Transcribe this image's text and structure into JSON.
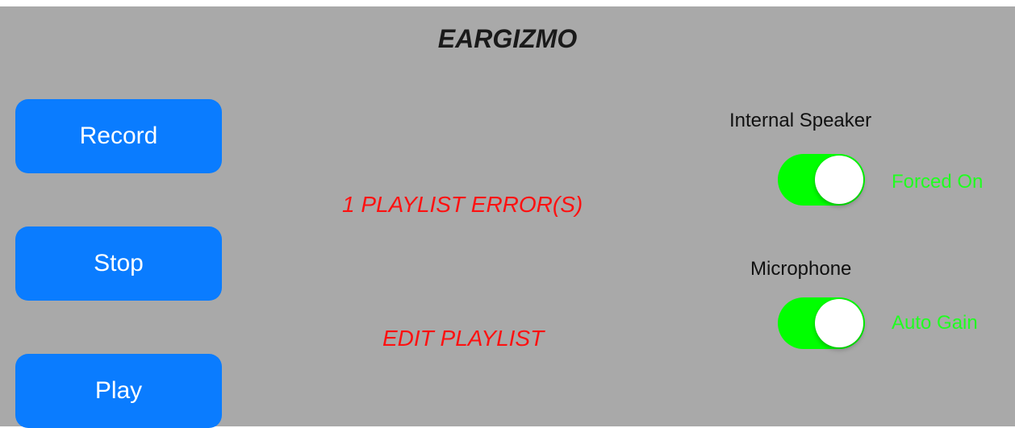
{
  "app": {
    "title": "EARGIZMO"
  },
  "buttons": {
    "record_label": "Record",
    "stop_label": "Stop",
    "play_label": "Play"
  },
  "playlist": {
    "error_text": "1 PLAYLIST ERROR(S)",
    "edit_label": "EDIT PLAYLIST"
  },
  "internal_speaker": {
    "label": "Internal Speaker",
    "toggle_on": true,
    "state_text": "Forced On"
  },
  "microphone": {
    "label": "Microphone",
    "toggle_on": true,
    "state_text": "Auto Gain"
  },
  "colors": {
    "background": "#a9a9a9",
    "button": "#0a7cff",
    "link": "#ff1111",
    "toggle_on": "#00ff00",
    "state_text": "#20ff20"
  }
}
